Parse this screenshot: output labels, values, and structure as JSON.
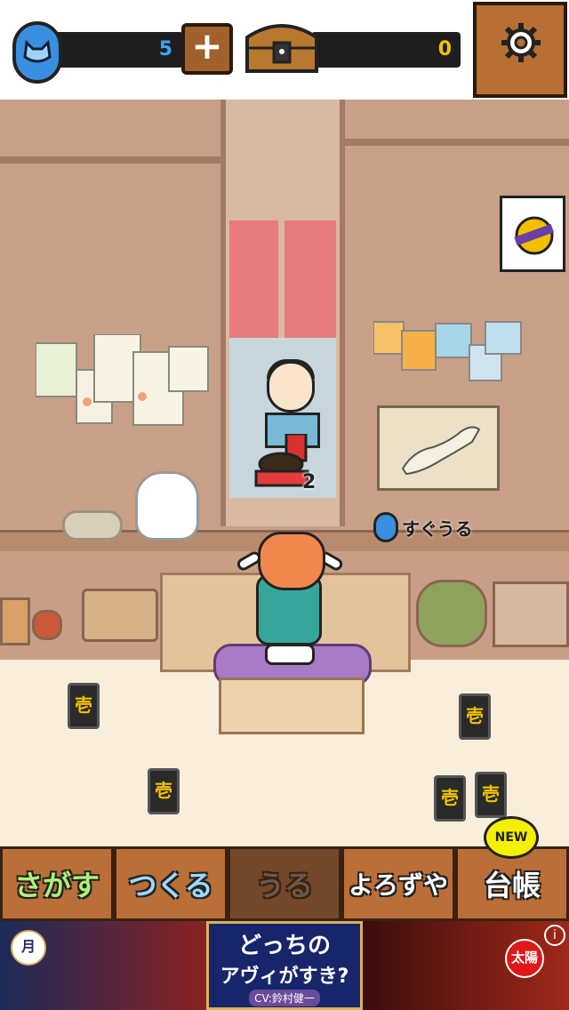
{
  "header": {
    "coins": "5",
    "add_coins_label": "+",
    "treasure": "0"
  },
  "scene": {
    "tray_count": "2",
    "sell_now_label": "すぐうる",
    "card_glyph": "壱"
  },
  "tabs": [
    {
      "label": "さがす"
    },
    {
      "label": "つくる"
    },
    {
      "label": "うる"
    },
    {
      "label": "よろずや"
    },
    {
      "label": "台帳"
    }
  ],
  "new_badge": "NEW",
  "ad": {
    "line1": "どっちの",
    "line2": "アヴィがすき?",
    "cv": "CV:鈴村健一",
    "left_badge": "月",
    "right_badge": "太陽",
    "info": "i"
  },
  "icons": {
    "coin": "cat-coin-icon",
    "chest": "treasure-chest-icon",
    "settings": "gear-icon"
  },
  "colors": {
    "coin_value": "#3aa6ff",
    "treasure_value": "#f2c200",
    "tab_wood": "#b96f37"
  }
}
